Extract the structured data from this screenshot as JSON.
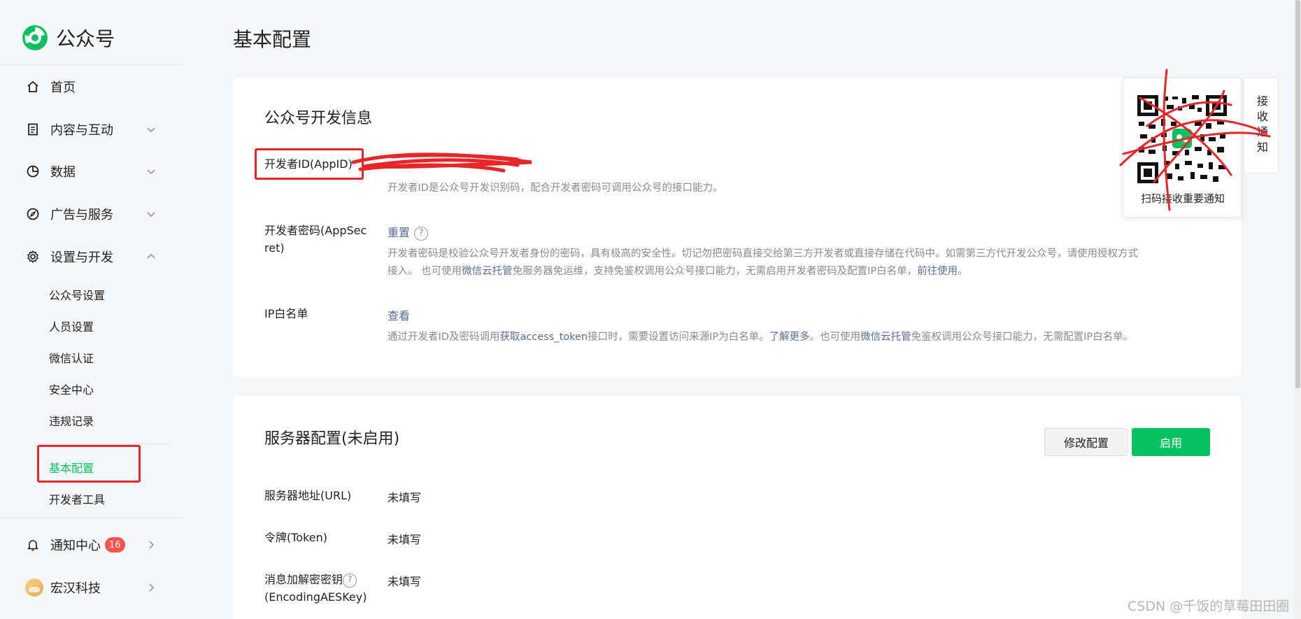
{
  "brand": {
    "name": "公众号"
  },
  "page": {
    "title": "基本配置"
  },
  "sidebar": {
    "items": [
      {
        "label": "首页"
      },
      {
        "label": "内容与互动"
      },
      {
        "label": "数据"
      },
      {
        "label": "广告与服务"
      },
      {
        "label": "设置与开发"
      }
    ],
    "sub_items": [
      "公众号设置",
      "人员设置",
      "微信认证",
      "安全中心",
      "违规记录",
      "基本配置",
      "开发者工具"
    ],
    "notify": {
      "label": "通知中心",
      "count": "16"
    },
    "account": {
      "label": "宏汉科技"
    }
  },
  "dev_info": {
    "title": "公众号开发信息",
    "appid": {
      "label": "开发者ID(AppID)",
      "desc": "开发者ID是公众号开发识别码，配合开发者密码可调用公众号的接口能力。"
    },
    "secret": {
      "label_line1": "开发者密码(AppSec",
      "label_line2": "ret)",
      "action": "重置",
      "desc_line1": "开发者密码是校验公众号开发者身份的密码，具有极高的安全性。切记勿把密码直接交给第三方开发者或直接存储在代码中。如需第三方代开发公众号，请使用授权方式",
      "desc_line2_a": "接入。 也可使用",
      "desc_link1": "微信云托管",
      "desc_line2_b": "免服务器免运维，支持免鉴权调用公众号接口能力，无需启用开发者密码及配置IP白名单，",
      "desc_link2": "前往使用",
      "desc_end": "。"
    },
    "ip": {
      "label": "IP白名单",
      "action": "查看",
      "desc_a": "通过开发者ID及密码调用",
      "desc_link1": "获取access_token",
      "desc_b": "接口时，需要设置访问来源IP为白名单。",
      "desc_link2": "了解更多",
      "desc_c": "。也可使用",
      "desc_link3": "微信云托管",
      "desc_d": "免鉴权调用公众号接口能力，无需配置IP白名单。"
    }
  },
  "server": {
    "title": "服务器配置(未启用)",
    "modify_label": "修改配置",
    "enable_label": "启用",
    "url": {
      "label": "服务器地址(URL)",
      "value": "未填写"
    },
    "token": {
      "label": "令牌(Token)",
      "value": "未填写"
    },
    "aes": {
      "label_line1": "消息加解密密钥",
      "label_line2": "(EncodingAESKey)",
      "value": "未填写"
    }
  },
  "qr": {
    "caption": "扫码接收重要通知",
    "tab": "接收通知"
  },
  "help_mark": "?",
  "watermark": "CSDN @千饭的草莓田田圈",
  "colors": {
    "accent": "#07c160",
    "link": "#576b95",
    "badge": "#fa5151",
    "annotation": "#e8262a"
  }
}
